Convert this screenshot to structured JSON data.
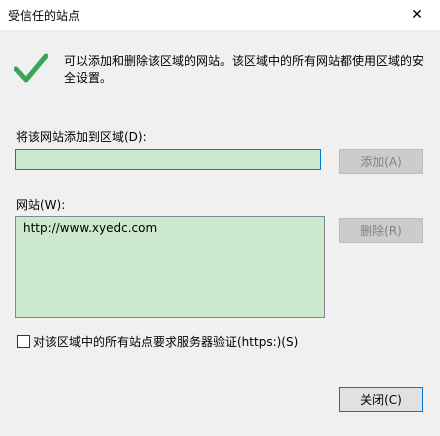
{
  "window": {
    "title": "受信任的站点",
    "close_glyph": "✕"
  },
  "info": {
    "icon": "check-icon",
    "text": "可以添加和删除该区域的网站。该区域中的所有网站都使用区域的安全设置。"
  },
  "add_site": {
    "label": "将该网站添加到区域(D):",
    "value": "",
    "add_button": "添加(A)"
  },
  "sites": {
    "label": "网站(W):",
    "items": [
      "http://www.xyedc.com"
    ],
    "remove_button": "删除(R)"
  },
  "https_option": {
    "checked": false,
    "label": "对该区域中的所有站点要求服务器验证(https:)(S)"
  },
  "footer": {
    "close_button": "关闭(C)"
  },
  "colors": {
    "field_background": "#cce8cf",
    "checkmark": "#3aa655",
    "focus_border": "#0078d7"
  }
}
